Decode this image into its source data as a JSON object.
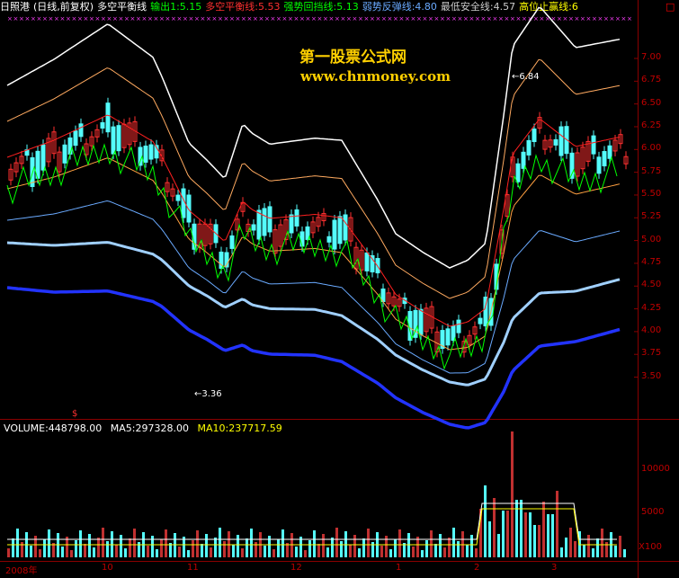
{
  "header": {
    "stock": "日照港",
    "mode": "(日线,前复权)",
    "indicator": "多空平衡线",
    "out1": "输出1:5.15",
    "balance": "多空平衡线:5.53",
    "strong_pull": "强势回挡线:5.13",
    "weak_bounce": "弱势反弹线:4.80",
    "safe_line": "最低安全线:4.57",
    "high_stop": "高位止赢线:6",
    "corner": "□"
  },
  "watermark": {
    "line1": "第一股票公式网",
    "line2": "www.chnmoney.com"
  },
  "price_axis": [
    "7.00",
    "6.75",
    "6.50",
    "6.25",
    "6.00",
    "5.75",
    "5.50",
    "5.25",
    "5.00",
    "4.75",
    "4.50",
    "4.25",
    "4.00",
    "3.75",
    "3.50"
  ],
  "annotations": {
    "high": "6.84",
    "low": "3.36",
    "marker": "$"
  },
  "volume": {
    "label": "VOLUME:448798.00",
    "ma5": "MA5:297328.00",
    "ma10": "MA10:237717.59",
    "axis": [
      "10000",
      "5000"
    ],
    "unit": "X100"
  },
  "time_axis": {
    "year": "2008年",
    "months": [
      "10",
      "11",
      "12",
      "1",
      "2",
      "3"
    ]
  },
  "colors": {
    "up": "#ff3030",
    "down": "#54fcfc",
    "bg": "#000000",
    "border": "#8a0000",
    "balance": "#ff2020",
    "strong": "#00ff00",
    "weak": "#6aaaff",
    "safe": "#ffa040",
    "stop": "#ffffff",
    "support": "#2233ff"
  }
}
